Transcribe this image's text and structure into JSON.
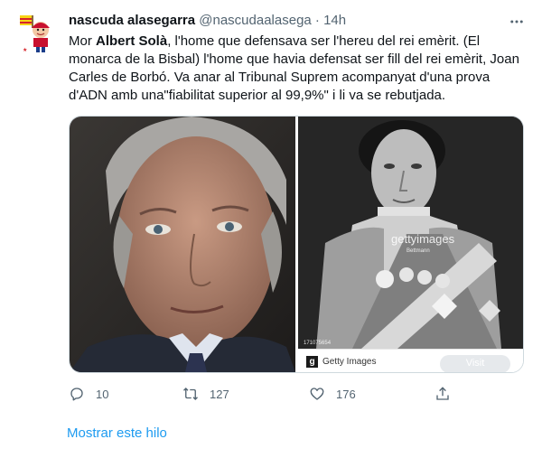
{
  "tweet": {
    "display_name": "nascuda alasegarra",
    "handle": "@nascudaalasega",
    "separator": "·",
    "time": "14h",
    "text_before": "Mor ",
    "text_bold": "Albert Solà",
    "text_after": ", l'home que defensava ser l'hereu del rei emèrit. (El monarca de la Bisbal) l'home que havia defensat ser fill del rei emèrit, Joan Carles de Borbó. Va anar al Tribunal Suprem acompanyat d'una prova d'ADN amb una\"fiabilitat superior al 99,9%\" i li va se rebutjada."
  },
  "media": {
    "watermark": "gettyimages",
    "watermark_sub": "Bettmann",
    "image_id": "171075654",
    "provider_label": "Getty Images",
    "provider_logo": "g",
    "visit_label": "Visit"
  },
  "actions": {
    "reply_count": "10",
    "retweet_count": "127",
    "like_count": "176"
  },
  "show_thread_label": "Mostrar este hilo",
  "icons": {
    "more": "more-horizontal-icon",
    "reply": "reply-icon",
    "retweet": "retweet-icon",
    "like": "heart-icon",
    "share": "share-icon"
  },
  "colors": {
    "link": "#1d9bf0",
    "secondary_text": "#536471",
    "primary_text": "#0f1419"
  }
}
